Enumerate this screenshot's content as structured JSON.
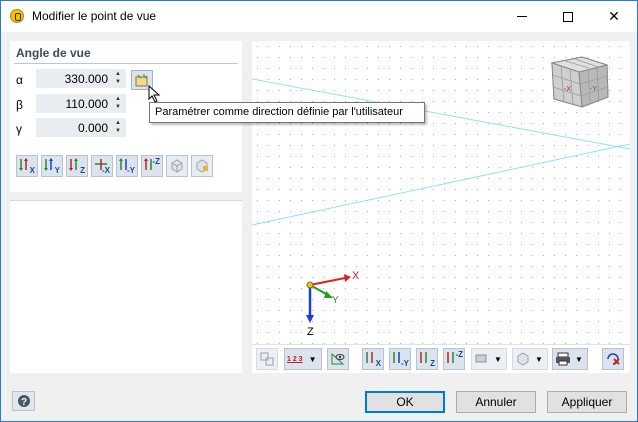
{
  "window": {
    "title": "Modifier le point de vue"
  },
  "panel": {
    "title": "Angle de vue"
  },
  "angles": [
    {
      "label": "α",
      "value": "330.000"
    },
    {
      "label": "β",
      "value": "110.000"
    },
    {
      "label": "γ",
      "value": "0.000"
    }
  ],
  "tooltip": "Paramétrer comme direction définie par l'utilisateur",
  "view_buttons": [
    "X",
    "Y",
    "Z",
    "-X",
    "-Y",
    "-Z"
  ],
  "axes": {
    "x": "X",
    "y": "Y",
    "z": "Z"
  },
  "cube": {
    "face_y": "-Y",
    "face_x": "-X"
  },
  "viewport_toolbar": {
    "numbering": "1 2 3",
    "views": [
      "X",
      "-Y",
      "Z",
      "-Z"
    ]
  },
  "buttons": {
    "ok": "OK",
    "cancel": "Annuler",
    "apply": "Appliquer"
  },
  "colors": {
    "accent": "#0078d7",
    "x_axis": "#e02020",
    "y_axis": "#20a020",
    "z_axis": "#1a3fd0",
    "grid_line": "#8fe3f0"
  }
}
